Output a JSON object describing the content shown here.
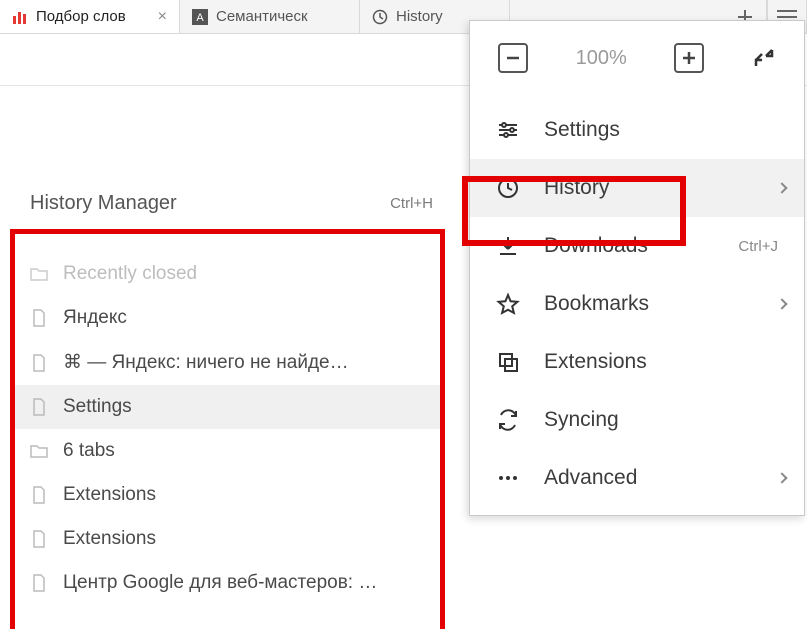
{
  "tabs": [
    {
      "label": "Подбор слов",
      "active": true,
      "icon": "bars-red"
    },
    {
      "label": "Семантическ",
      "active": false,
      "icon": "letter-a"
    },
    {
      "label": "History",
      "active": false,
      "icon": "clock"
    }
  ],
  "zoom": {
    "level": "100%"
  },
  "menu": {
    "settings": {
      "label": "Settings"
    },
    "history": {
      "label": "History"
    },
    "downloads": {
      "label": "Downloads",
      "shortcut": "Ctrl+J"
    },
    "bookmarks": {
      "label": "Bookmarks"
    },
    "extensions": {
      "label": "Extensions"
    },
    "syncing": {
      "label": "Syncing"
    },
    "advanced": {
      "label": "Advanced"
    }
  },
  "history_panel": {
    "title": "History Manager",
    "shortcut": "Ctrl+H",
    "items": [
      {
        "label": "Recently closed",
        "icon": "folder",
        "disabled": true
      },
      {
        "label": "Яндекс",
        "icon": "page"
      },
      {
        "label": "⌘ — Яндекс: ничего не найде…",
        "icon": "page"
      },
      {
        "label": "Settings",
        "icon": "page",
        "selected": true
      },
      {
        "label": "6 tabs",
        "icon": "folder"
      },
      {
        "label": "Extensions",
        "icon": "page"
      },
      {
        "label": "Extensions",
        "icon": "page"
      },
      {
        "label": "Центр Google для веб-мастеров: …",
        "icon": "page"
      }
    ]
  }
}
